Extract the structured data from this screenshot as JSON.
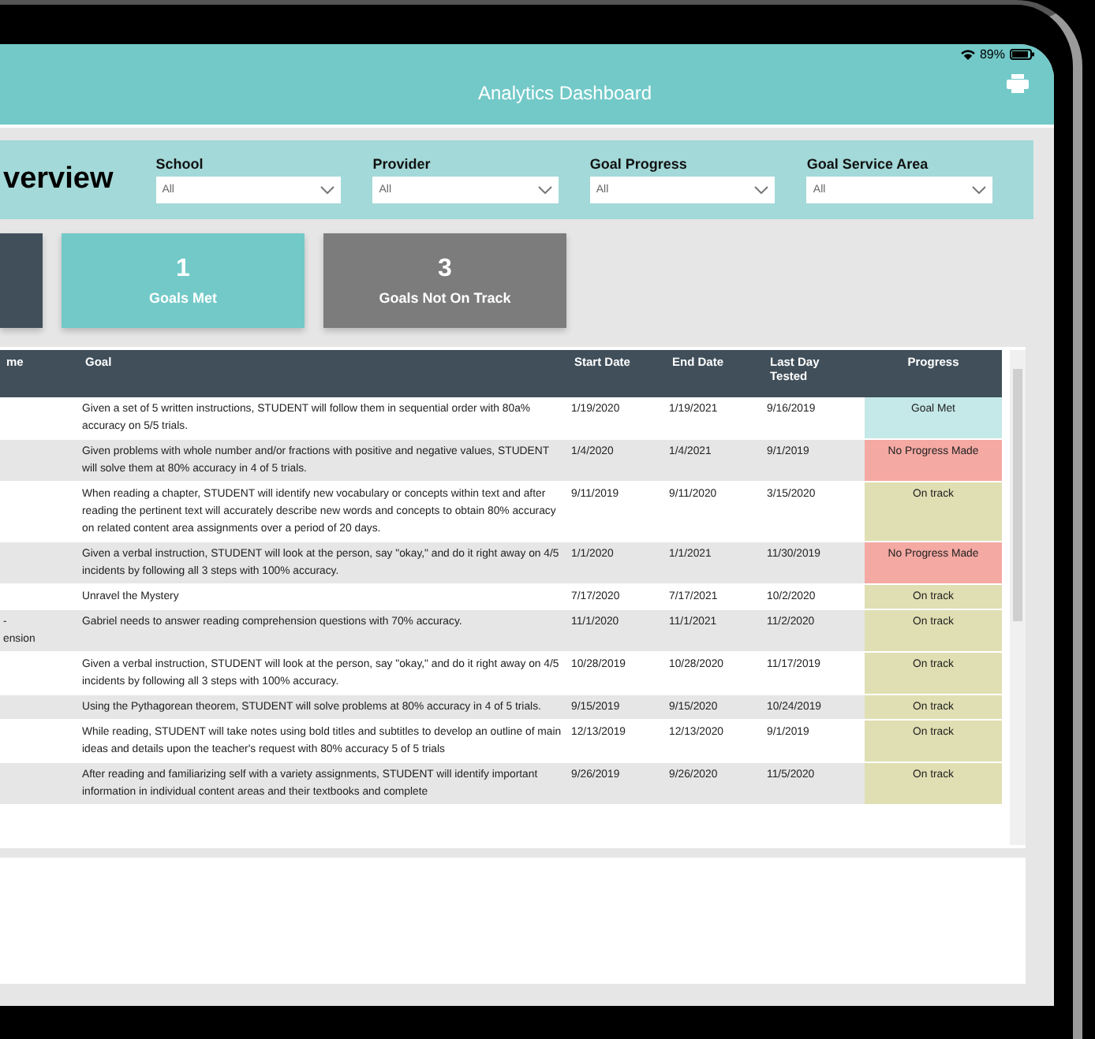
{
  "status_bar": {
    "battery": "89%"
  },
  "header": {
    "title": "Analytics Dashboard"
  },
  "filters": {
    "title": "verview",
    "items": [
      {
        "label": "School",
        "value": "All"
      },
      {
        "label": "Provider",
        "value": "All"
      },
      {
        "label": "Goal Progress",
        "value": "All"
      },
      {
        "label": "Goal Service Area",
        "value": "All"
      }
    ]
  },
  "cards": [
    {
      "kind": "dark"
    },
    {
      "kind": "teal",
      "value": "1",
      "label": "Goals Met"
    },
    {
      "kind": "gray",
      "value": "3",
      "label": "Goals Not On Track"
    }
  ],
  "table": {
    "columns": [
      "me",
      "Goal",
      "Start Date",
      "End Date",
      "Last Day Tested",
      "Progress"
    ],
    "rows": [
      {
        "column_1": "",
        "goal": "Given a set of 5 written instructions, STUDENT will follow them in sequential order with 80a% accuracy on 5/5 trials.",
        "start": "1/19/2020",
        "end": "1/19/2021",
        "last": "9/16/2019",
        "progress": "Goal Met",
        "kind": "met"
      },
      {
        "column_1": "",
        "goal": "Given problems with whole number and/or fractions with positive and negative values, STUDENT will solve them at 80% accuracy in 4 of 5 trials.",
        "start": "1/4/2020",
        "end": "1/4/2021",
        "last": "9/1/2019",
        "progress": "No Progress Made",
        "kind": "none"
      },
      {
        "column_1": "",
        "goal": "When reading a chapter, STUDENT will identify new vocabulary or concepts within text and after reading the pertinent text will accurately describe new words and concepts to obtain 80% accuracy on related content area assignments over a period of 20 days.",
        "start": "9/11/2019",
        "end": "9/11/2020",
        "last": "3/15/2020",
        "progress": "On track",
        "kind": "on_track"
      },
      {
        "column_1": "",
        "goal": "Given a verbal instruction, STUDENT will look at the person, say \"okay,\" and do it right away on 4/5 incidents by following all 3 steps with 100% accuracy.",
        "start": "1/1/2020",
        "end": "1/1/2021",
        "last": "11/30/2019",
        "progress": "No Progress Made",
        "kind": "none"
      },
      {
        "column_1": "",
        "goal": "Unravel the Mystery",
        "start": "7/17/2020",
        "end": "7/17/2021",
        "last": "10/2/2020",
        "progress": "On track",
        "kind": "on_track"
      },
      {
        "column_1": "- ension",
        "goal": "Gabriel needs to answer reading comprehension questions with 70% accuracy.",
        "start": "11/1/2020",
        "end": "11/1/2021",
        "last": "11/2/2020",
        "progress": "On track",
        "kind": "on_track"
      },
      {
        "column_1": "",
        "goal": "Given a verbal instruction, STUDENT will look at the person, say \"okay,\" and do it right away on 4/5 incidents by following all 3 steps with 100% accuracy.",
        "start": "10/28/2019",
        "end": "10/28/2020",
        "last": "11/17/2019",
        "progress": "On track",
        "kind": "on_track"
      },
      {
        "column_1": "",
        "goal": "Using the Pythagorean theorem, STUDENT will solve problems at 80% accuracy in 4 of 5 trials.",
        "start": "9/15/2019",
        "end": "9/15/2020",
        "last": "10/24/2019",
        "progress": "On track",
        "kind": "on_track"
      },
      {
        "column_1": "",
        "goal": "While reading, STUDENT will take notes using bold titles and subtitles to develop an outline of main ideas and details upon the teacher's request with 80% accuracy 5 of 5 trials",
        "start": "12/13/2019",
        "end": "12/13/2020",
        "last": "9/1/2019",
        "progress": "On track",
        "kind": "on_track"
      },
      {
        "column_1": "",
        "goal": "After reading and familiarizing self with a variety assignments, STUDENT will identify important information in individual content areas and their textbooks and complete",
        "start": "9/26/2019",
        "end": "9/26/2020",
        "last": "11/5/2020",
        "progress": "On track",
        "kind": "on_track"
      }
    ]
  }
}
